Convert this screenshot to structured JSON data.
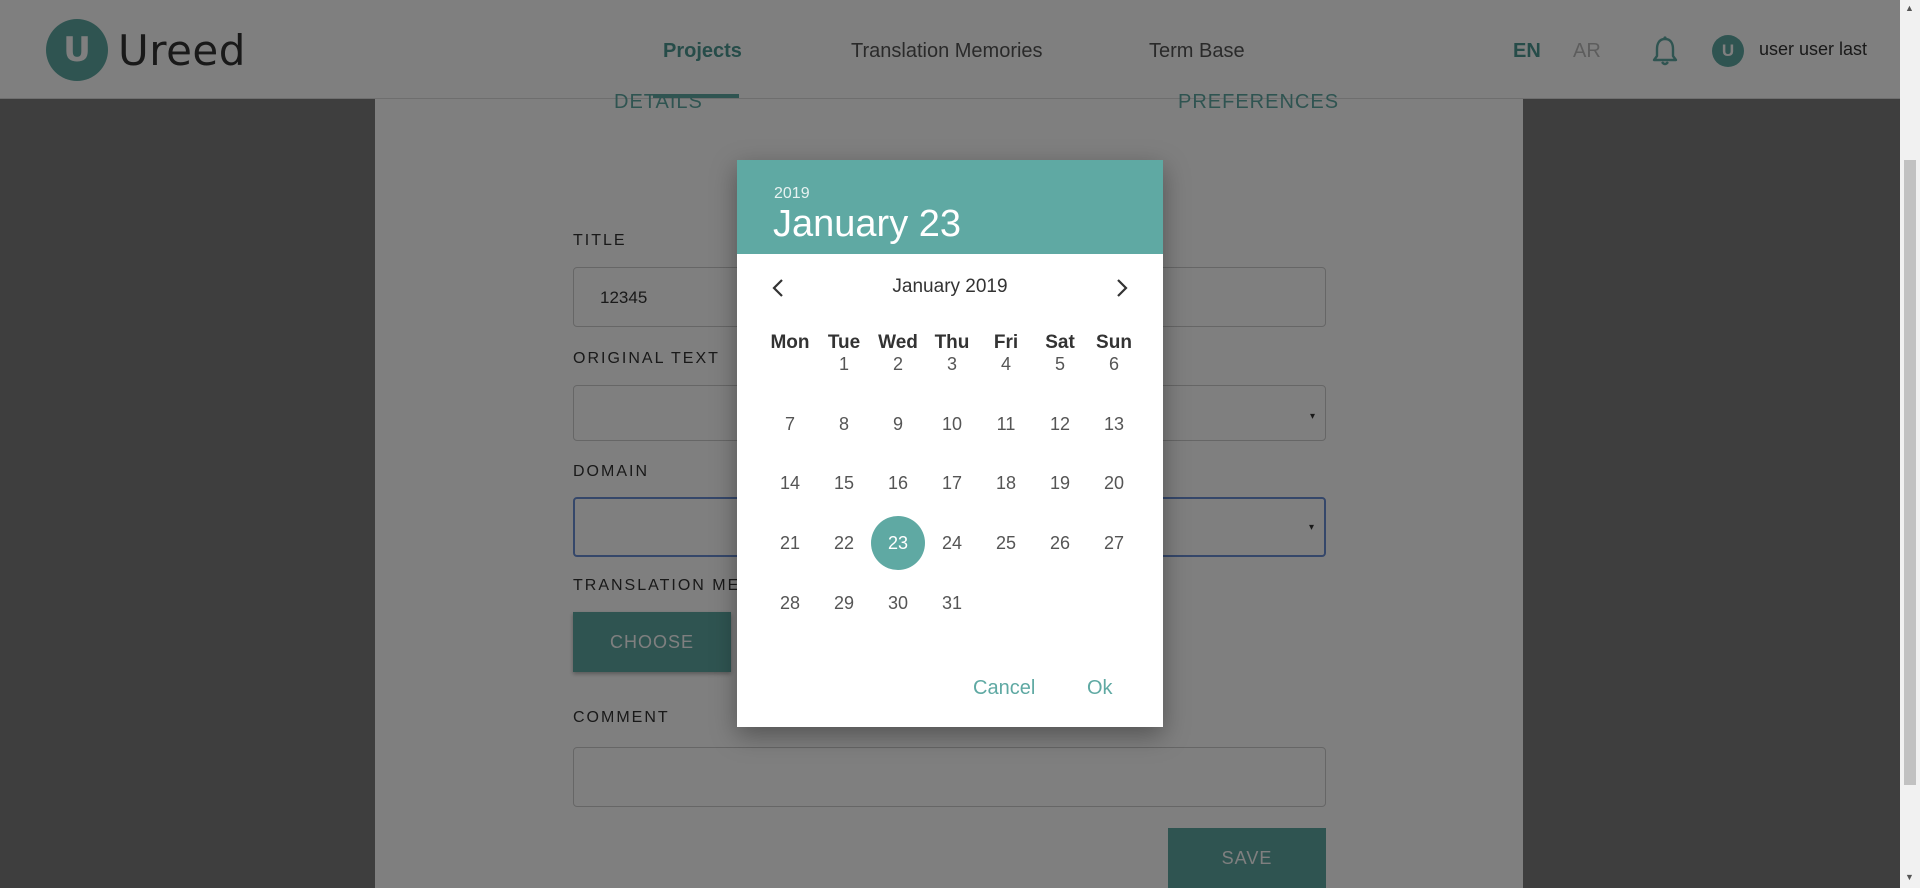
{
  "header": {
    "logo_mark": "U",
    "logo_text": "Ureed",
    "nav": [
      {
        "label": "Projects",
        "active": true
      },
      {
        "label": "Translation Memories",
        "active": false
      },
      {
        "label": "Term Base",
        "active": false
      }
    ],
    "lang_en": "EN",
    "lang_ar": "AR",
    "user_initial": "U",
    "username": "user user last"
  },
  "form": {
    "tab_details": "DETAILS",
    "tab_preferences": "PREFERENCES",
    "title_label": "TITLE",
    "title_value": "12345",
    "original_text_label": "ORIGINAL TEXT",
    "domain_label": "DOMAIN",
    "tm_label": "TRANSLATION MEMORIES",
    "choose_label": "CHOOSE",
    "comment_label": "COMMENT",
    "save_label": "SAVE",
    "caret": "▾"
  },
  "picker": {
    "year": "2019",
    "date": "January 23",
    "month_label": "January 2019",
    "weekdays": [
      "Mon",
      "Tue",
      "Wed",
      "Thu",
      "Fri",
      "Sat",
      "Sun"
    ],
    "first_weekday_index": 1,
    "days_in_month": 31,
    "selected_day": 23,
    "cancel_label": "Cancel",
    "ok_label": "Ok"
  },
  "colors": {
    "accent": "#5fa9a3",
    "focus_border": "#6b8fd4"
  }
}
